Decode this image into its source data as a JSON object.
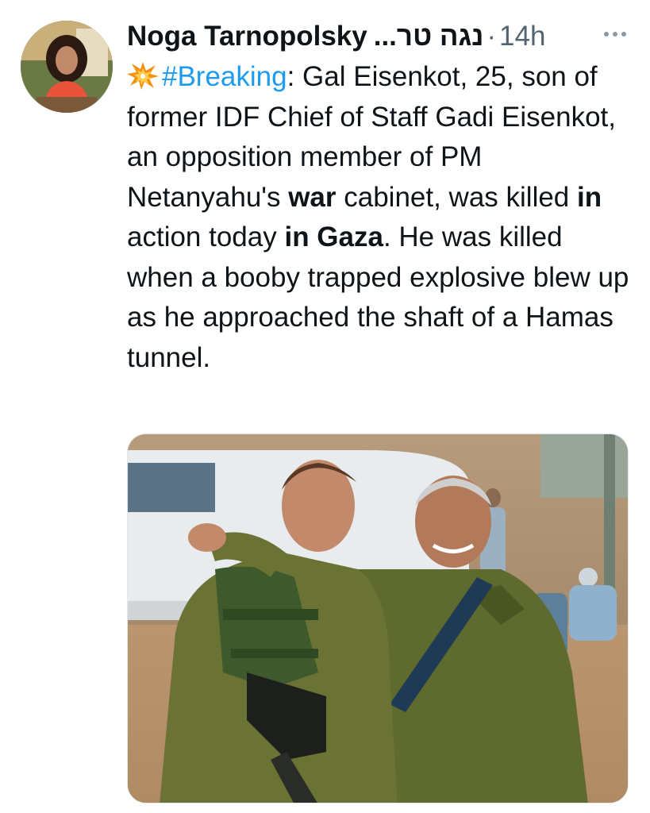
{
  "author": {
    "display_name": "Noga Tarnopolsky",
    "hebrew_name": "נגה טר...",
    "separator": "·",
    "time": "14h"
  },
  "tweet": {
    "hashtag": "#Breaking",
    "t1": ": Gal Eisenkot, 25, son of former IDF Chief of Staff Gadi Eisenkot, an opposition member of PM Netanyahu's ",
    "b1": "war",
    "t2": " cabinet, was killed ",
    "b2": "in",
    "t3": " action today ",
    "b3": "in Gaza",
    "t4": ". He was killed when a booby trapped explosive blew up as he approached the shaft of a Hamas tunnel."
  },
  "colors": {
    "link": "#1d9bf0",
    "muted": "#536471",
    "text": "#0f1419"
  },
  "icons": {
    "collision": "collision-emoji",
    "more": "more-dots-icon"
  }
}
